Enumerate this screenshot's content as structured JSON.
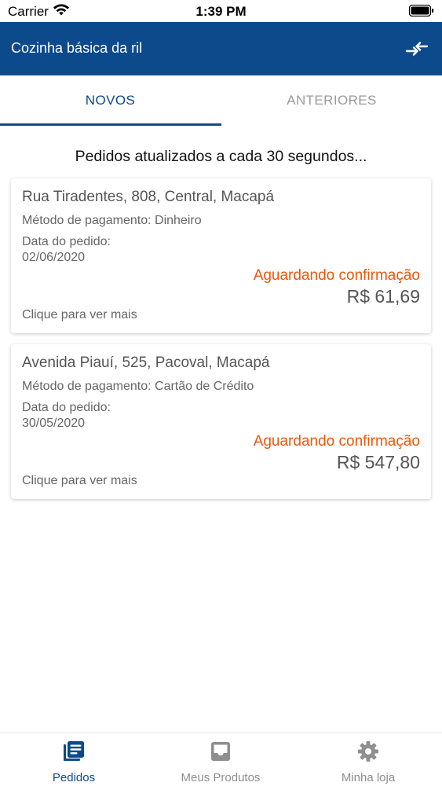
{
  "status_bar": {
    "carrier": "Carrier",
    "time": "1:39 PM"
  },
  "header": {
    "title": "Cozinha básica da ril",
    "switch_icon": "switch-arrows-icon"
  },
  "tabs": [
    {
      "label": "NOVOS",
      "active": true
    },
    {
      "label": "ANTERIORES",
      "active": false
    }
  ],
  "refresh_note": "Pedidos atualizados a cada 30 segundos...",
  "orders": [
    {
      "address": "Rua Tiradentes, 808, Central, Macapá",
      "payment": "Método de pagamento: Dinheiro",
      "date_label": "Data do pedido:",
      "date": "02/06/2020",
      "status": "Aguardando confirmação",
      "total": "R$ 61,69",
      "more": "Clique para ver mais"
    },
    {
      "address": "Avenida Piauí, 525, Pacoval, Macapá",
      "payment": "Método de pagamento: Cartão de Crédito",
      "date_label": "Data do pedido:",
      "date": "30/05/2020",
      "status": "Aguardando confirmação",
      "total": "R$ 547,80",
      "more": "Clique para ver mais"
    }
  ],
  "tab_bar": [
    {
      "label": "Pedidos",
      "icon": "orders-list-icon",
      "active": true
    },
    {
      "label": "Meus Produtos",
      "icon": "inbox-icon",
      "active": false
    },
    {
      "label": "Minha loja",
      "icon": "gear-icon",
      "active": false
    }
  ],
  "colors": {
    "primary": "#0c4a8c",
    "status_pending": "#e8590c",
    "inactive": "#8e8e8e"
  }
}
